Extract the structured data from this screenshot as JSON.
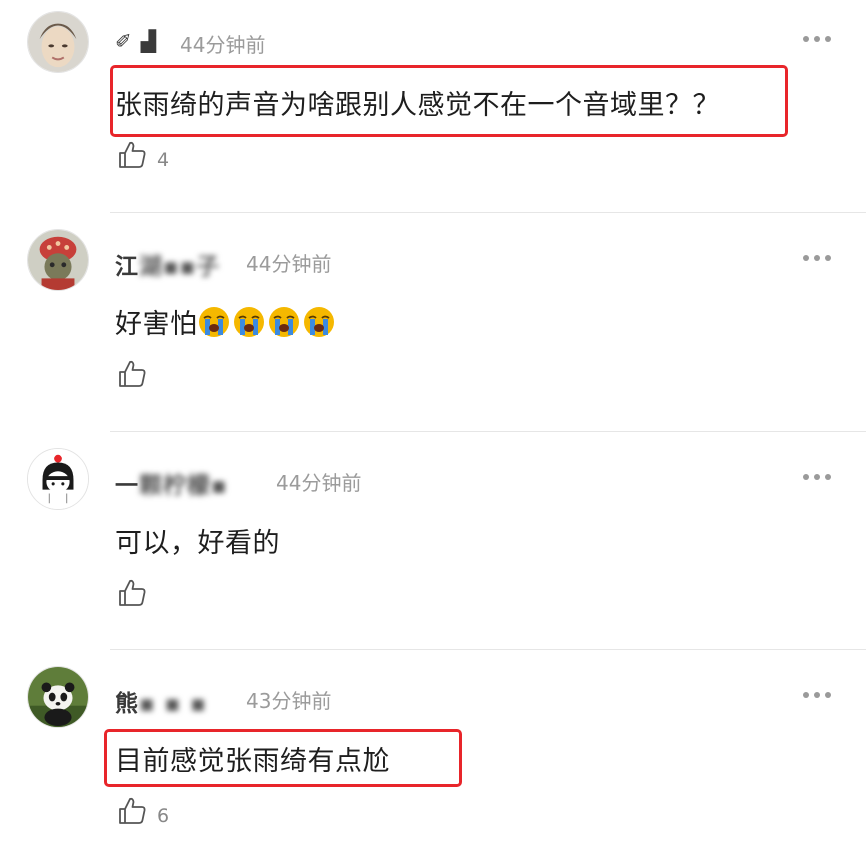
{
  "comments": [
    {
      "username_visible": "✐ ▟",
      "time": "44分钟前",
      "text": "张雨绮的声音为啥跟别人感觉不在一个音域里？？",
      "likes": "4",
      "highlighted": true
    },
    {
      "username_visible": "江",
      "username_blurred": "湖▪▪子",
      "time": "44分钟前",
      "text": "好害怕",
      "emoji": [
        "loudly-crying-face",
        "loudly-crying-face",
        "loudly-crying-face",
        "loudly-crying-face"
      ],
      "likes": "",
      "highlighted": false
    },
    {
      "username_visible": "一",
      "username_blurred": "颗柠檬▪",
      "time": "44分钟前",
      "text": "可以，好看的",
      "likes": "",
      "highlighted": false
    },
    {
      "username_visible": "熊",
      "username_blurred": "▪ ▪ ▪",
      "time": "43分钟前",
      "text": "目前感觉张雨绮有点尬",
      "likes": "6",
      "highlighted": true
    }
  ],
  "colors": {
    "highlight_border": "#e8252a",
    "timestamp": "#9b9b9b",
    "divider": "#e6e6e6"
  },
  "icons": {
    "like": "thumbs-up-icon",
    "more": "more-dots-icon"
  }
}
